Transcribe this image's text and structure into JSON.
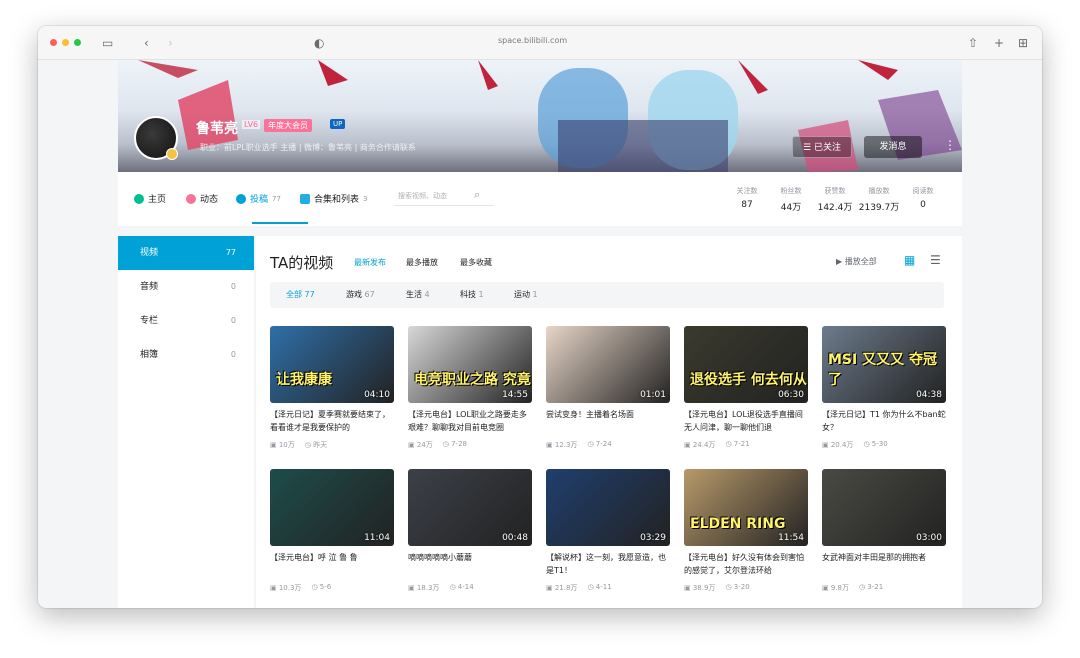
{
  "browser": {
    "url": "space.bilibili.com",
    "colors": {
      "close": "#fe5f57",
      "minimize": "#febc2e",
      "maximize": "#28c840"
    }
  },
  "profile": {
    "username": "鲁苇亮",
    "level": "LV6",
    "vip": "年度大会员",
    "up_tag": "UP",
    "signature": "职业：前LPL职业选手  主播  |  微博：鲁苇亮  |  商务合作请联系"
  },
  "header_buttons": {
    "follow": "已关注",
    "message": "发消息",
    "more": "⋮"
  },
  "nav": {
    "items": [
      {
        "label": "主页",
        "count": "",
        "color": "#00c091"
      },
      {
        "label": "动态",
        "count": "",
        "color": "#fb7299"
      },
      {
        "label": "投稿",
        "count": "77",
        "color": "#00a1d6"
      },
      {
        "label": "合集和列表",
        "count": "3",
        "color": "#23ade5"
      }
    ],
    "search_placeholder": "搜索视频、动态"
  },
  "stats": [
    {
      "label": "关注数",
      "value": "87"
    },
    {
      "label": "粉丝数",
      "value": "44万"
    },
    {
      "label": "获赞数",
      "value": "142.4万"
    },
    {
      "label": "播放数",
      "value": "2139.7万"
    },
    {
      "label": "阅读数",
      "value": "0"
    }
  ],
  "sidebar": {
    "items": [
      {
        "label": "视频",
        "count": "77"
      },
      {
        "label": "音频",
        "count": "0"
      },
      {
        "label": "专栏",
        "count": "0"
      },
      {
        "label": "相簿",
        "count": "0"
      }
    ]
  },
  "main": {
    "title": "TA的视频",
    "sort_tabs": [
      "最新发布",
      "最多播放",
      "最多收藏"
    ],
    "play_all": "▶ 播放全部",
    "filters": [
      {
        "label": "全部",
        "count": "77"
      },
      {
        "label": "游戏",
        "count": "67"
      },
      {
        "label": "生活",
        "count": "4"
      },
      {
        "label": "科技",
        "count": "1"
      },
      {
        "label": "运动",
        "count": "1"
      }
    ]
  },
  "videos": [
    {
      "title": "【泽元日记】夏季赛就要结束了，看看谁才是我要保护的",
      "duration": "04:10",
      "views": "10万",
      "date": "昨天",
      "overlay": "让我康康",
      "color": "#2f6fa8"
    },
    {
      "title": "【泽元电台】LOL职业之路要走多艰难？聊聊我对目前电竞圈",
      "duration": "14:55",
      "views": "24万",
      "date": "7-28",
      "overlay": "电竞职业之路 究竟",
      "color": "#d8d8d8"
    },
    {
      "title": "尝试变身！主播着名场面",
      "duration": "01:01",
      "views": "12.3万",
      "date": "7-24",
      "overlay": "",
      "color": "#e8d6c8"
    },
    {
      "title": "【泽元电台】LOL退役选手直播间无人问津，聊一聊他们退",
      "duration": "06:30",
      "views": "24.4万",
      "date": "7-21",
      "overlay": "退役选手 何去何从",
      "color": "#3a3a2e"
    },
    {
      "title": "【泽元日记】T1 你为什么不ban蛇女？",
      "duration": "04:38",
      "views": "20.4万",
      "date": "5-30",
      "overlay": "MSI 又又又 夺冠了",
      "color": "#6c7b8c"
    },
    {
      "title": "【泽元电台】呼 泣 鲁 鲁",
      "duration": "11:04",
      "views": "10.3万",
      "date": "5-6",
      "overlay": "",
      "color": "#1d4c4a"
    },
    {
      "title": "嘀嘀嘀嘀嘀小蘑蘑",
      "duration": "00:48",
      "views": "18.3万",
      "date": "4-14",
      "overlay": "",
      "color": "#3c4048"
    },
    {
      "title": "【解说杯】这一刻，我愿意造，也是T1！",
      "duration": "03:29",
      "views": "21.8万",
      "date": "4-11",
      "overlay": "",
      "color": "#1f3f6e"
    },
    {
      "title": "【泽元电台】好久没有体会到害怕的感觉了，艾尔登法环给",
      "duration": "11:54",
      "views": "38.9万",
      "date": "3-20",
      "overlay": "ELDEN RING",
      "color": "#b89a6a"
    },
    {
      "title": "女武神面对丰田是那的拥抱者",
      "duration": "03:00",
      "views": "9.8万",
      "date": "3-21",
      "overlay": "",
      "color": "#4a4a44"
    }
  ]
}
